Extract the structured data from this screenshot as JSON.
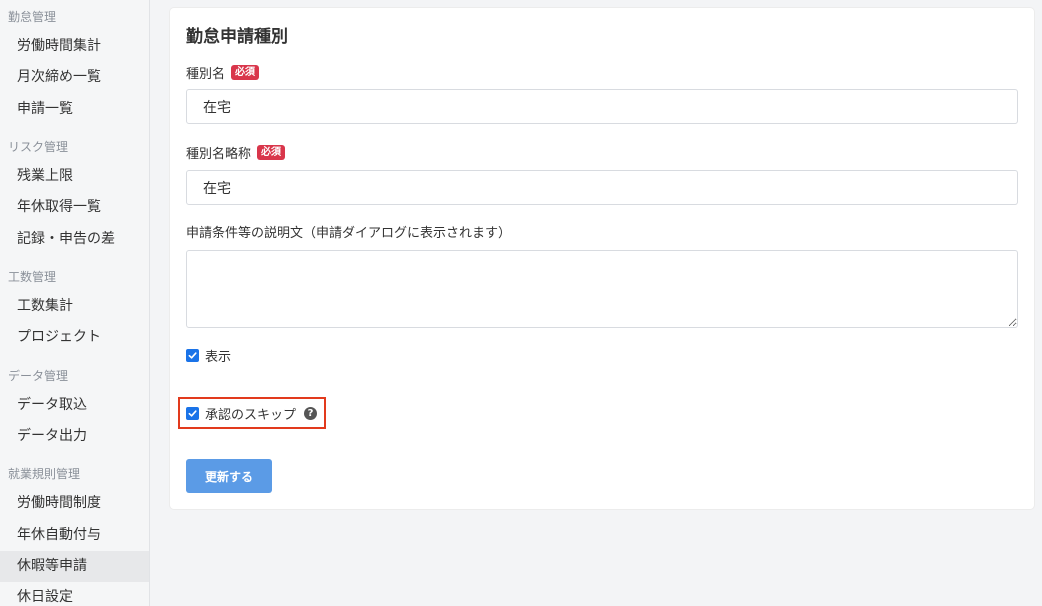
{
  "sidebar": {
    "groups": [
      {
        "title": "勤怠管理",
        "items": [
          "労働時間集計",
          "月次締め一覧",
          "申請一覧"
        ]
      },
      {
        "title": "リスク管理",
        "items": [
          "残業上限",
          "年休取得一覧",
          "記録・申告の差"
        ]
      },
      {
        "title": "工数管理",
        "items": [
          "工数集計",
          "プロジェクト"
        ]
      },
      {
        "title": "データ管理",
        "items": [
          "データ取込",
          "データ出力"
        ]
      },
      {
        "title": "就業規則管理",
        "items": [
          "労働時間制度",
          "年休自動付与",
          "休暇等申請",
          "休日設定"
        ]
      }
    ]
  },
  "form": {
    "title": "勤怠申請種別",
    "required_badge": "必須",
    "name_label": "種別名",
    "name_value": "在宅",
    "short_label": "種別名略称",
    "short_value": "在宅",
    "desc_label": "申請条件等の説明文（申請ダイアログに表示されます）",
    "desc_value": "",
    "show_label": "表示",
    "skip_label": "承認のスキップ",
    "help_glyph": "?",
    "submit_label": "更新する"
  },
  "colors": {
    "accent": "#5b9be6",
    "required": "#d9364b",
    "highlight": "#e23a1d"
  }
}
